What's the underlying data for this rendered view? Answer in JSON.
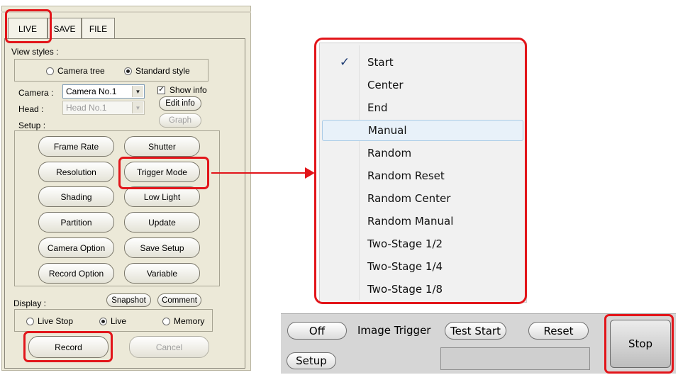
{
  "left_panel": {
    "tabs": [
      {
        "label": "LIVE",
        "active": true
      },
      {
        "label": "SAVE",
        "active": false
      },
      {
        "label": "FILE",
        "active": false
      }
    ],
    "view_styles": {
      "label": "View styles :",
      "camera_tree": "Camera tree",
      "standard_style": "Standard style",
      "selected": "Standard style"
    },
    "camera": {
      "label": "Camera :",
      "value": "Camera No.1"
    },
    "head": {
      "label": "Head :",
      "value": "Head No.1"
    },
    "show_info": {
      "label": "Show info",
      "checked": true
    },
    "edit_info": "Edit info",
    "graph": "Graph",
    "setup": {
      "label": "Setup :",
      "buttons": [
        "Frame Rate",
        "Shutter",
        "Resolution",
        "Trigger Mode",
        "Shading",
        "Low Light",
        "Partition",
        "Update",
        "Camera Option",
        "Save Setup",
        "Record Option",
        "Variable"
      ]
    },
    "display": {
      "label": "Display :",
      "snapshot": "Snapshot",
      "comment": "Comment",
      "live_stop": "Live Stop",
      "live": "Live",
      "memory": "Memory",
      "selected": "Live"
    },
    "record": "Record",
    "cancel": "Cancel"
  },
  "trigger_menu": {
    "checked": "Start",
    "highlighted": "Manual",
    "items": [
      "Start",
      "Center",
      "End",
      "Manual",
      "Random",
      "Random Reset",
      "Random Center",
      "Random Manual",
      "Two-Stage 1/2",
      "Two-Stage 1/4",
      "Two-Stage 1/8"
    ]
  },
  "image_trigger_bar": {
    "off": "Off",
    "title": "Image Trigger",
    "test_start": "Test Start",
    "reset": "Reset",
    "setup": "Setup",
    "stop": "Stop"
  },
  "colors": {
    "annotation_red": "#e2151a",
    "panel_bg": "#ece9d8",
    "menu_highlight": "#e8f1f9"
  }
}
